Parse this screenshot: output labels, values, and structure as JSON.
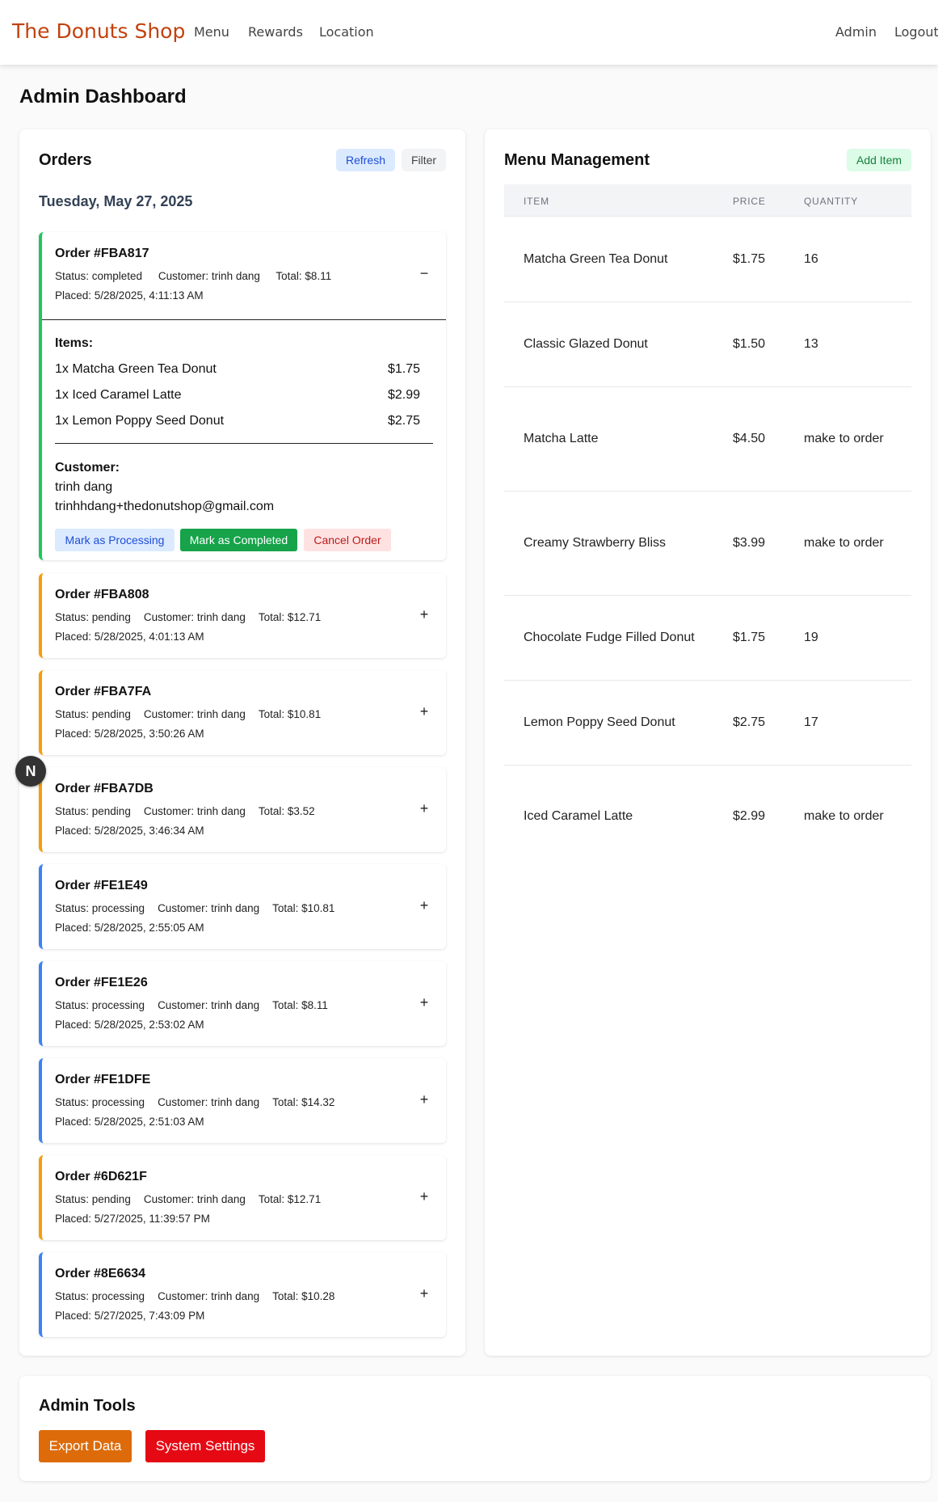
{
  "nav": {
    "brand": "The Donuts Shop",
    "links": [
      "Menu",
      "Rewards",
      "Location"
    ],
    "right_links": [
      "Admin",
      "Logout"
    ]
  },
  "page_title": "Admin Dashboard",
  "orders_panel": {
    "title": "Orders",
    "refresh_label": "Refresh",
    "filter_label": "Filter",
    "date": "Tuesday, May 27, 2025",
    "orders": [
      {
        "id": "Order #FBA817",
        "status": "Status: completed",
        "customer": "Customer: trinh dang",
        "total": "Total: $8.11",
        "placed": "Placed: 5/28/2025, 4:11:13 AM",
        "toggle": "−",
        "expanded": true,
        "items_label": "Items:",
        "items": [
          {
            "name": "1x Matcha Green Tea Donut",
            "price": "$1.75"
          },
          {
            "name": "1x Iced Caramel Latte",
            "price": "$2.99"
          },
          {
            "name": "1x Lemon Poppy Seed Donut",
            "price": "$2.75"
          }
        ],
        "customer_label": "Customer:",
        "customer_name": "trinh dang",
        "customer_email": "trinhhdang+thedonutshop@gmail.com",
        "actions": {
          "processing": "Mark as Processing",
          "completed": "Mark as Completed",
          "cancel": "Cancel Order"
        }
      },
      {
        "id": "Order #FBA808",
        "status": "Status: pending",
        "customer": "Customer: trinh dang",
        "total": "Total: $12.71",
        "placed": "Placed: 5/28/2025, 4:01:13 AM",
        "toggle": "+"
      },
      {
        "id": "Order #FBA7FA",
        "status": "Status: pending",
        "customer": "Customer: trinh dang",
        "total": "Total: $10.81",
        "placed": "Placed: 5/28/2025, 3:50:26 AM",
        "toggle": "+"
      },
      {
        "id": "Order #FBA7DB",
        "status": "Status: pending",
        "customer": "Customer: trinh dang",
        "total": "Total: $3.52",
        "placed": "Placed: 5/28/2025, 3:46:34 AM",
        "toggle": "+"
      },
      {
        "id": "Order #FE1E49",
        "status": "Status: processing",
        "customer": "Customer: trinh dang",
        "total": "Total: $10.81",
        "placed": "Placed: 5/28/2025, 2:55:05 AM",
        "toggle": "+"
      },
      {
        "id": "Order #FE1E26",
        "status": "Status: processing",
        "customer": "Customer: trinh dang",
        "total": "Total: $8.11",
        "placed": "Placed: 5/28/2025, 2:53:02 AM",
        "toggle": "+"
      },
      {
        "id": "Order #FE1DFE",
        "status": "Status: processing",
        "customer": "Customer: trinh dang",
        "total": "Total: $14.32",
        "placed": "Placed: 5/28/2025, 2:51:03 AM",
        "toggle": "+"
      },
      {
        "id": "Order #6D621F",
        "status": "Status: pending",
        "customer": "Customer: trinh dang",
        "total": "Total: $12.71",
        "placed": "Placed: 5/27/2025, 11:39:57 PM",
        "toggle": "+"
      },
      {
        "id": "Order #8E6634",
        "status": "Status: processing",
        "customer": "Customer: trinh dang",
        "total": "Total: $10.28",
        "placed": "Placed: 5/27/2025, 7:43:09 PM",
        "toggle": "+"
      }
    ]
  },
  "menu_panel": {
    "title": "Menu Management",
    "add_label": "Add Item",
    "columns": [
      "ITEM",
      "PRICE",
      "QUANTITY"
    ],
    "rows": [
      [
        "Matcha Green Tea Donut",
        "$1.75",
        "16"
      ],
      [
        "Classic Glazed Donut",
        "$1.50",
        "13"
      ],
      [
        "Matcha Latte",
        "$4.50",
        "make to order"
      ],
      [
        "Creamy Strawberry Bliss",
        "$3.99",
        "make to order"
      ],
      [
        "Chocolate Fudge Filled Donut",
        "$1.75",
        "19"
      ],
      [
        "Lemon Poppy Seed Donut",
        "$2.75",
        "17"
      ],
      [
        "Iced Caramel Latte",
        "$2.99",
        "make to order"
      ]
    ]
  },
  "badge": {
    "letter": "N"
  },
  "admin_tools": {
    "title": "Admin Tools",
    "export_label": "Export Data",
    "settings_label": "System Settings"
  },
  "colors": {
    "brand": "#c2410c",
    "pending": "#f59e0b",
    "processing": "#3b82f6",
    "completed": "#22c55e",
    "export": "#dd6b0a",
    "settings": "#e50914"
  }
}
